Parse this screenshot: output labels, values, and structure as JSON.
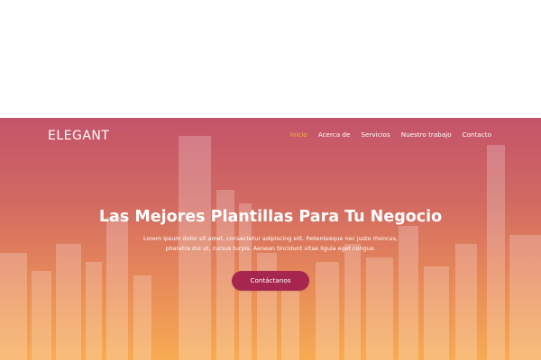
{
  "header": {
    "brand": "ELEGANT",
    "nav": [
      {
        "label": "Inicio",
        "active": true
      },
      {
        "label": "Acerca de",
        "active": false
      },
      {
        "label": "Servicios",
        "active": false
      },
      {
        "label": "Nuestro trabajo",
        "active": false
      },
      {
        "label": "Contacto",
        "active": false
      }
    ]
  },
  "hero": {
    "title": "Las Mejores Plantillas Para Tu Negocio",
    "description_line1": "Lorem ipsum dolor sit amet, consectetur adipiscing elit. Pellentesque nec justo rhoncus,",
    "description_line2": "pharetra dui ut, cursus turpis. Aenean tincidunt vitae ligula eget congue.",
    "cta_label": "Contáctanos"
  },
  "colors": {
    "accent_active": "#f6b24d",
    "cta_background": "#a7264e",
    "gradient_top": "#c4536a",
    "gradient_bottom": "#f7ab52"
  }
}
